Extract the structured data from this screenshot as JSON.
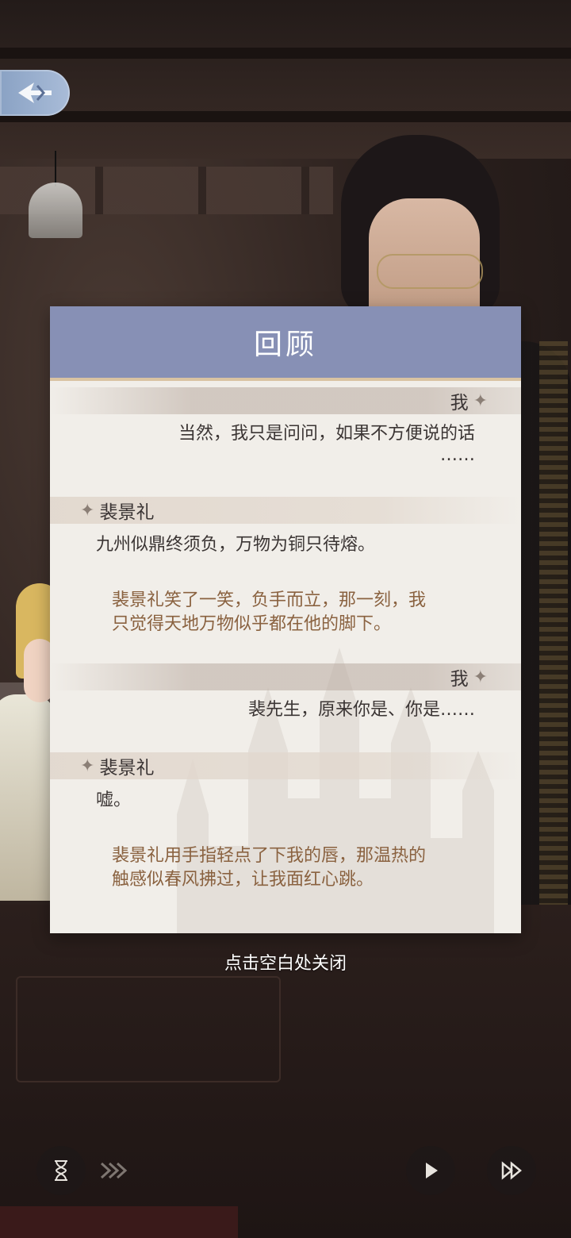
{
  "dialog": {
    "title": "回顾",
    "entries": [
      {
        "speaker": "我",
        "side": "right",
        "text": "当然，我只是问问，如果不方便说的话",
        "text_cont": "……"
      },
      {
        "speaker": "裴景礼",
        "side": "left",
        "text": "九州似鼎终须负，万物为铜只待熔。",
        "narration": [
          "裴景礼笑了一笑，负手而立，那一刻，我",
          "只觉得天地万物似乎都在他的脚下。"
        ]
      },
      {
        "speaker": "我",
        "side": "right",
        "text": "裴先生，原来你是、你是……"
      },
      {
        "speaker": "裴景礼",
        "side": "left",
        "text": "嘘。",
        "narration": [
          "裴景礼用手指轻点了下我的唇，那温热的",
          "触感似春风拂过，让我面红心跳。"
        ]
      }
    ]
  },
  "close_hint": "点击空白处关闭",
  "icons": {
    "back": "back-arrow-icon",
    "hourglass": "hourglass-icon",
    "auto": "fast-forward-arrows-icon",
    "play": "play-icon",
    "skip": "skip-forward-icon"
  },
  "colors": {
    "header": "#8790b5",
    "panel": "#f1eee9",
    "narration": "#8a6240"
  }
}
